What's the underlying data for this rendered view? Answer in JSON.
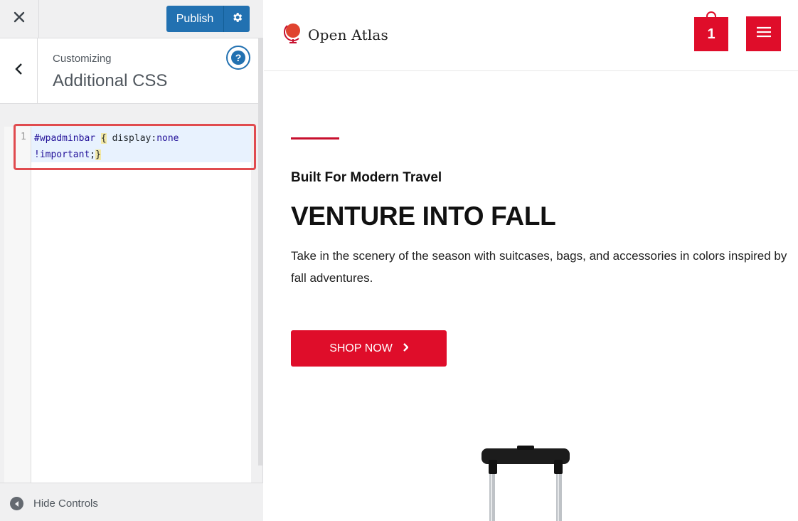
{
  "customizer": {
    "publish_label": "Publish",
    "section_label": "Customizing",
    "section_title": "Additional CSS",
    "help_label": "?",
    "editor": {
      "line_number": "1",
      "code_tokens": {
        "selector": "#wpadminbar",
        "open_brace": "{",
        "property": "display:",
        "value": "none",
        "important": "!important",
        "semicolon": ";",
        "close_brace": "}"
      }
    },
    "hide_controls_label": "Hide Controls"
  },
  "preview": {
    "brand_name": "Open Atlas",
    "cart_count": "1",
    "hero": {
      "subtitle": "Built For Modern Travel",
      "title": "VENTURE INTO FALL",
      "description": "Take in the scenery of the season with suitcases, bags, and accessories in colors inspired by fall adventures.",
      "cta_label": "SHOP NOW"
    }
  },
  "colors": {
    "wp_blue": "#2271b1",
    "brand_red": "#df0d2a",
    "highlight_red": "#e04b4f"
  }
}
